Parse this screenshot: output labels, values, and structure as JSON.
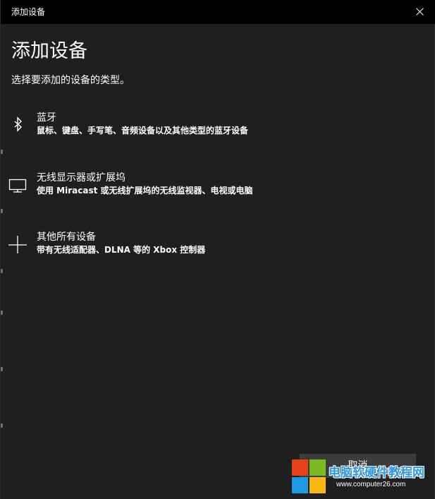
{
  "window": {
    "title": "添加设备"
  },
  "dialog": {
    "heading": "添加设备",
    "subtitle": "选择要添加的设备的类型。"
  },
  "options": [
    {
      "icon": "bluetooth-icon",
      "label": "蓝牙",
      "description": "鼠标、键盘、手写笔、音频设备以及其他类型的蓝牙设备"
    },
    {
      "icon": "monitor-icon",
      "label": "无线显示器或扩展坞",
      "description": "使用 Miracast 或无线扩展坞的无线监视器、电视或电脑"
    },
    {
      "icon": "plus-icon",
      "label": "其他所有设备",
      "description": "带有无线适配器、DLNA 等的 Xbox 控制器"
    }
  ],
  "footer": {
    "cancel_label": "取消"
  },
  "watermark": {
    "title": "电脑软硬件教程网",
    "url": "www.computer26.com"
  },
  "colors": {
    "background": "#1f1f1f",
    "titlebar": "#000000",
    "button": "#3b3b3b",
    "watermark_blue": "#2c97e6"
  }
}
